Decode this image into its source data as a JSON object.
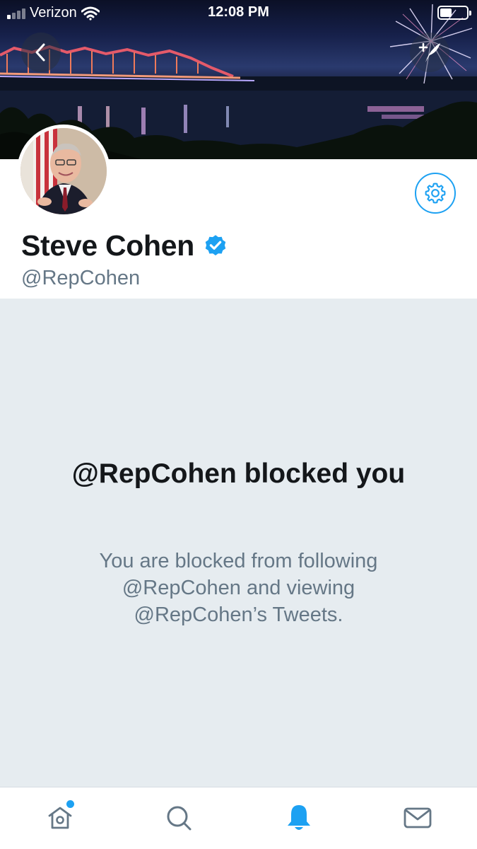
{
  "status_bar": {
    "carrier": "Verizon",
    "time": "12:08 PM",
    "battery_level": 0.45
  },
  "header": {
    "back_icon": "chevron-left-icon",
    "compose_icon": "compose-tweet-icon"
  },
  "profile": {
    "display_name": "Steve Cohen",
    "verified": true,
    "handle": "@RepCohen",
    "settings_icon": "gear-icon"
  },
  "blocked": {
    "title": "@RepCohen blocked you",
    "description": "You are blocked from following @RepCohen and viewing @RepCohen’s Tweets."
  },
  "tab_bar": {
    "tabs": [
      {
        "icon": "home-icon",
        "active": false,
        "has_notification_dot": true
      },
      {
        "icon": "search-icon",
        "active": false
      },
      {
        "icon": "bell-icon",
        "active": true
      },
      {
        "icon": "mail-icon",
        "active": false
      }
    ]
  },
  "colors": {
    "accent": "#1da1f2",
    "text_primary": "#14171a",
    "text_secondary": "#657786",
    "blocked_background": "#e6ecf0",
    "inactive_icon": "#657786"
  }
}
